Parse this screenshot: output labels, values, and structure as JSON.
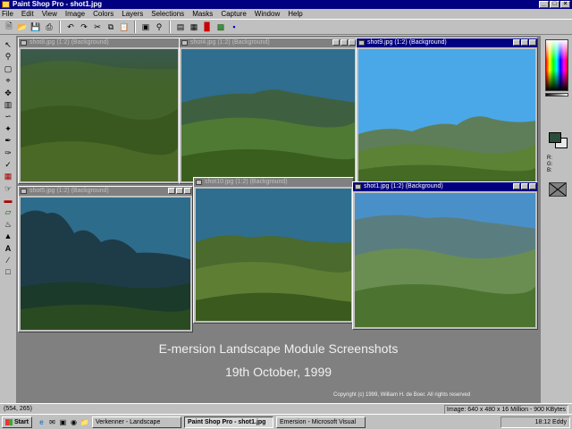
{
  "window": {
    "title": "Paint Shop Pro - shot1.jpg",
    "controls": [
      "_",
      "□",
      "×"
    ]
  },
  "menu": [
    "File",
    "Edit",
    "View",
    "Image",
    "Colors",
    "Layers",
    "Selections",
    "Masks",
    "Capture",
    "Window",
    "Help"
  ],
  "toolbar_icons": [
    "new-icon",
    "open-icon",
    "save-icon",
    "print-icon",
    "undo-icon",
    "redo-icon",
    "cut-icon",
    "copy-icon",
    "paste-icon",
    "browse-icon",
    "zoom-icon",
    "toggle-toolbar-icon",
    "toggle-palette-icon",
    "histogram-icon",
    "layers-icon",
    "overview-icon"
  ],
  "tools": [
    "arrow-icon",
    "zoom-tool-icon",
    "deformation-icon",
    "crop-icon",
    "mover-icon",
    "selection-icon",
    "freehand-icon",
    "magic-wand-icon",
    "dropper-icon",
    "paintbrush-icon",
    "clone-icon",
    "color-replacer-icon",
    "retouch-icon",
    "eraser-icon",
    "picture-tube-icon",
    "airbrush-icon",
    "flood-fill-icon",
    "text-icon",
    "line-icon",
    "shape-icon"
  ],
  "images": [
    {
      "title": "shot8.jpg (1:2) (Background)"
    },
    {
      "title": "shot4.jpg (1:2) (Background)"
    },
    {
      "title": "shot9.jpg (1:2) (Background)"
    },
    {
      "title": "shot5.jpg (1:2) (Background)"
    },
    {
      "title": "shot10.jpg (1:2) (Background)"
    },
    {
      "title": "shot1.jpg (1:2) (Background)"
    }
  ],
  "canvas_text": {
    "heading": "E-mersion Landscape Module Screenshots",
    "date": "19th October, 1999",
    "copyright": "Copyright (c) 1999, William H. de Boer. All rights reserved"
  },
  "palette": {
    "r": "R:",
    "g": "G:",
    "b": "B:",
    "foreground": "#2a4d3c",
    "background": "#e8e8e8"
  },
  "status": {
    "coords": "(554, 265)",
    "info": "Image: 640 x 480 x 16 Million - 900 KBytes"
  },
  "taskbar": {
    "start": "Start",
    "buttons": [
      "Verkenner - Landscape",
      "Paint Shop Pro - shot1.jpg",
      "Emersion - Microsoft Visual"
    ],
    "time": "18:12 Eddy"
  },
  "colors": {
    "title_active": "#000080",
    "desktop_gray": "#808080",
    "chrome": "#c0c0c0"
  }
}
